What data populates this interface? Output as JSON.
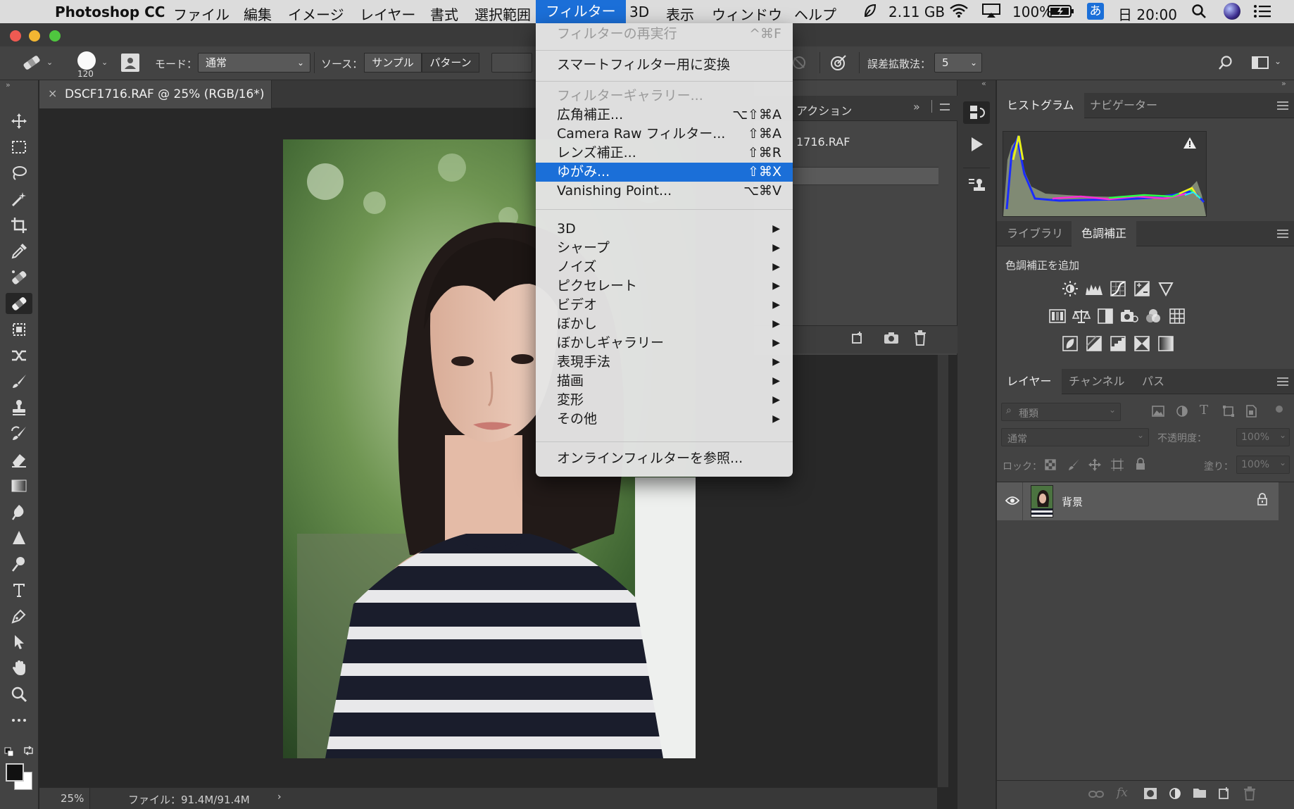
{
  "menubar": {
    "app_name": "Photoshop CC",
    "items": [
      "ファイル",
      "編集",
      "イメージ",
      "レイヤー",
      "書式",
      "選択範囲",
      "フィルター",
      "3D",
      "表示",
      "ウィンドウ",
      "ヘルプ"
    ],
    "memory": "2.11 GB",
    "battery": "100%",
    "input_method": "あ",
    "clock": "日 20:00"
  },
  "options": {
    "brush_size": "120",
    "mode_label": "モード：",
    "mode_value": "通常",
    "source_label": "ソース：",
    "sample_btn": "サンプル",
    "pattern_btn": "パターン",
    "diffusion_label": "誤差拡散法：",
    "diffusion_value": "5"
  },
  "document": {
    "tab_title": "DSCF1716.RAF @ 25% (RGB/16*)",
    "zoom": "25%",
    "file_info": "ファイル：91.4M/91.4M"
  },
  "actions": {
    "tab": "アクション",
    "item": "1716.RAF"
  },
  "filter_menu": {
    "repeat": {
      "label": "フィルターの再実行",
      "shortcut": "^⌘F"
    },
    "smart": {
      "label": "スマートフィルター用に変換"
    },
    "gallery": {
      "label": "フィルターギャラリー..."
    },
    "wide": {
      "label": "広角補正...",
      "shortcut": "⌥⇧⌘A"
    },
    "camera_raw": {
      "label": "Camera Raw フィルター...",
      "shortcut": "⇧⌘A"
    },
    "lens": {
      "label": "レンズ補正...",
      "shortcut": "⇧⌘R"
    },
    "liquify": {
      "label": "ゆがみ...",
      "shortcut": "⇧⌘X"
    },
    "vanishing": {
      "label": "Vanishing Point...",
      "shortcut": "⌥⌘V"
    },
    "submenus": [
      "3D",
      "シャープ",
      "ノイズ",
      "ピクセレート",
      "ビデオ",
      "ぼかし",
      "ぼかしギャラリー",
      "表現手法",
      "描画",
      "変形",
      "その他"
    ],
    "online": {
      "label": "オンラインフィルターを参照..."
    }
  },
  "histogram_panel": {
    "tabs": [
      "ヒストグラム",
      "ナビゲーター"
    ]
  },
  "adjust_panel": {
    "tabs": [
      "ライブラリ",
      "色調補正"
    ],
    "add_label": "色調補正を追加"
  },
  "layers_panel": {
    "tabs": [
      "レイヤー",
      "チャンネル",
      "パス"
    ],
    "filter_placeholder": "種類",
    "blend": "通常",
    "opacity_label": "不透明度：",
    "opacity_value": "100%",
    "lock_label": "ロック：",
    "fill_label": "塗り：",
    "fill_value": "100%",
    "layer_name": "背景"
  },
  "colors": {
    "accent": "#1b6fd8",
    "panel": "#434343",
    "canvas": "#282828"
  }
}
